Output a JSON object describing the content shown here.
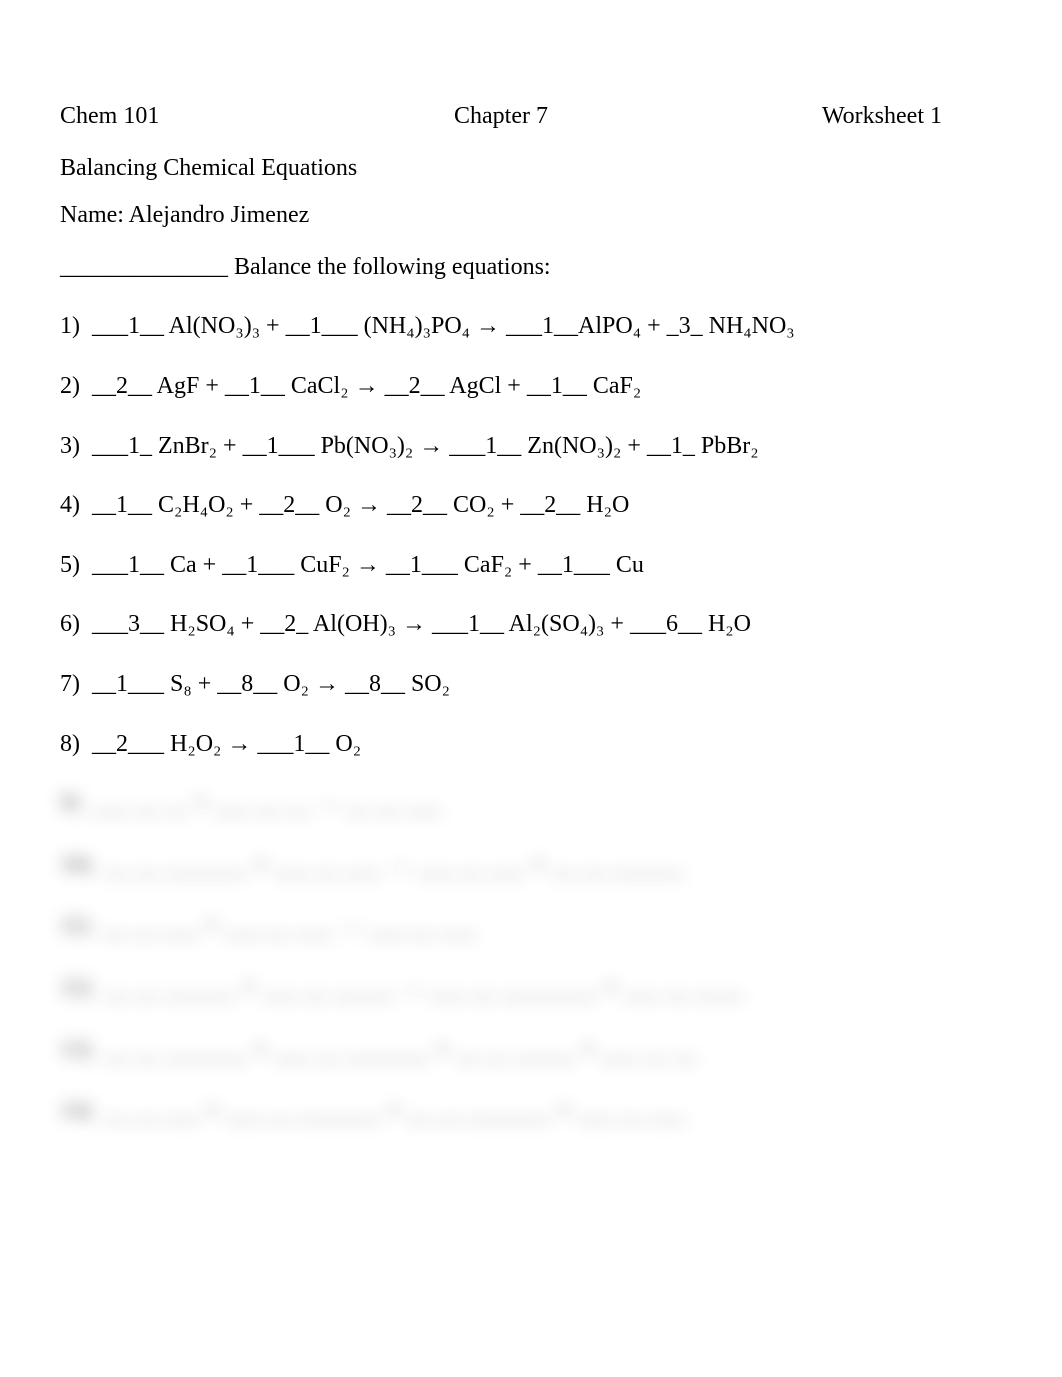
{
  "header": {
    "left": "Chem 101",
    "center": "Chapter 7",
    "right": "Worksheet 1"
  },
  "subtitle": "Balancing Chemical Equations",
  "name_label": "Name: ",
  "name_value": "Alejandro Jimenez",
  "instruction_prefix": "______________ ",
  "instruction_text": "Balance the following equations:",
  "equations": [
    {
      "num": "1)",
      "text": "___1__ Al(NO₃)₃ + __1___ (NH₄)₃PO₄ → ___1__AlPO₄ + _3_ NH₄NO₃"
    },
    {
      "num": "2)",
      "text": "__2__ AgF + __1__ CaCl₂ → __2__ AgCl + __1__ CaF₂"
    },
    {
      "num": "3)",
      "text": "___1_ ZnBr₂ + __1___ Pb(NO₃)₂ → ___1__ Zn(NO₃)₂ + __1_ PbBr₂"
    },
    {
      "num": "4)",
      "text": "__1__ C₂H₄O₂ + __2__ O₂ → __2__ CO₂ + __2__ H₂O"
    },
    {
      "num": "5)",
      "text": "___1__ Ca + __1___ CuF₂ → __1___ CaF₂ + __1___ Cu"
    },
    {
      "num": "6)",
      "text": "___3__ H₂SO₄ + __2_ Al(OH)₃ → ___1__ Al₂(SO₄)₃ + ___6__ H₂O"
    },
    {
      "num": "7)",
      "text": "__1___ S₈ + __8__ O₂ → __8__ SO₂"
    },
    {
      "num": "8)",
      "text": "__2___ H₂O₂ → ___1__ O₂"
    }
  ],
  "blurred_equations": [
    {
      "num": "9)",
      "text": "___ __  __ + ___ __  __ → __ __   ___"
    },
    {
      "num": "10)",
      "text": "__ __   _______ + ___ __  ___ → ___ __  ___ + __ __ ______"
    },
    {
      "num": "11)",
      "text": "__ __  ___ + ___ __  ___ → ___ __   ___"
    },
    {
      "num": "12)",
      "text": "__ __  ______ + ___ __ _____ → ___ __  ________ + ___ __  ____"
    },
    {
      "num": "13)",
      "text": "__ __  _______ + ___ __  _______ + __ __ _____ + ___ __ __"
    },
    {
      "num": "14)",
      "text": "__ __  ___ + ___ __  _______ + __ __   _______ + ___ __  ___"
    }
  ]
}
